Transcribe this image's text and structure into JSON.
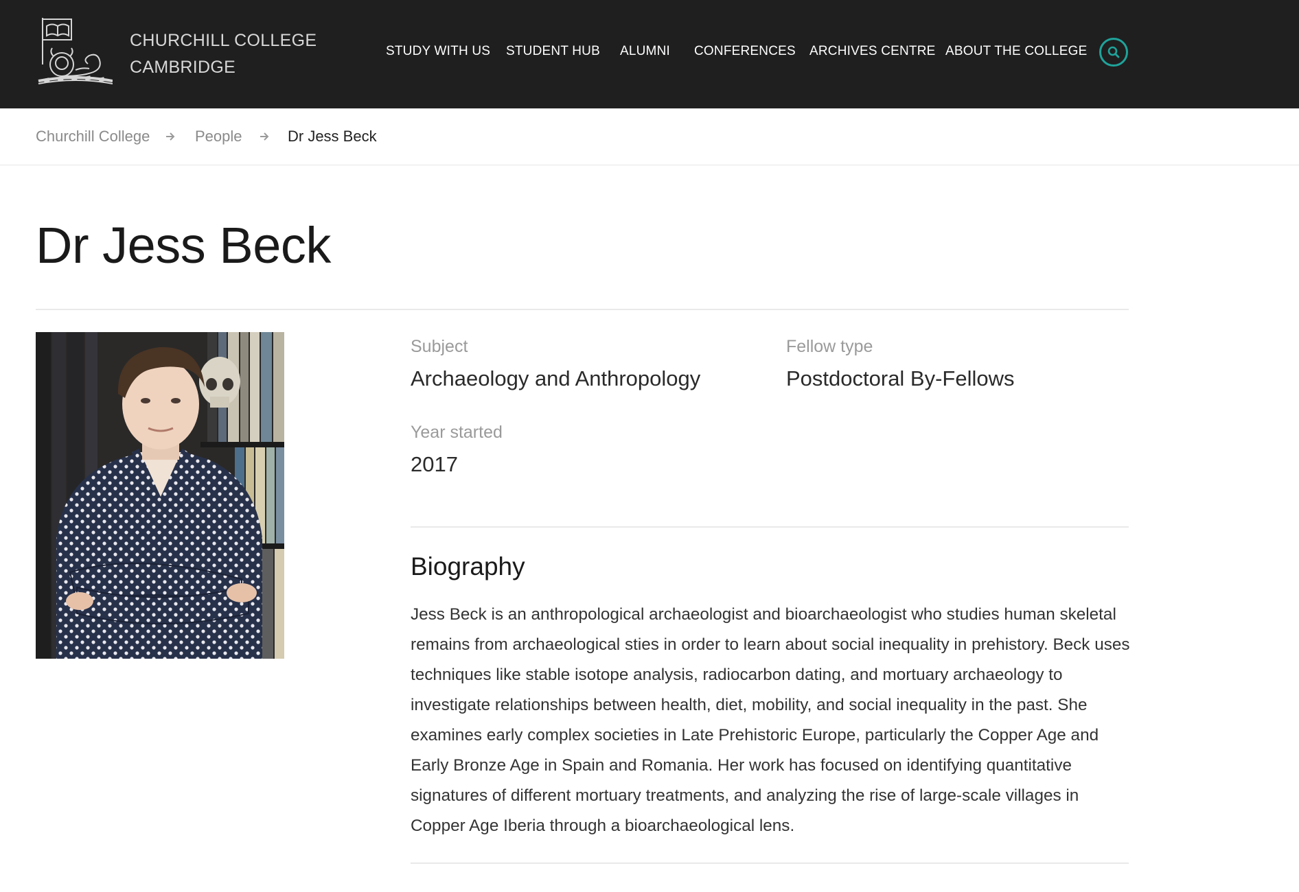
{
  "header": {
    "brand_line1": "CHURCHILL COLLEGE",
    "brand_line2": "CAMBRIDGE",
    "nav": [
      {
        "label": "STUDY WITH US"
      },
      {
        "label": "STUDENT HUB"
      },
      {
        "label": "ALUMNI"
      },
      {
        "label": "CONFERENCES"
      },
      {
        "label": "ARCHIVES CENTRE"
      },
      {
        "label": "ABOUT THE COLLEGE"
      }
    ],
    "search_icon": "search-icon",
    "accent_color": "#1fa39a",
    "background_color": "#1f1f20"
  },
  "breadcrumb": {
    "items": [
      {
        "label": "Churchill College"
      },
      {
        "label": "People"
      },
      {
        "label": "Dr Jess Beck"
      }
    ],
    "separator_icon": "arrow-right-icon"
  },
  "page": {
    "title": "Dr Jess Beck",
    "facts": {
      "subject_label": "Subject",
      "subject_value": "Archaeology and Anthropology",
      "fellow_type_label": "Fellow type",
      "fellow_type_value": "Postdoctoral By-Fellows",
      "year_started_label": "Year started",
      "year_started_value": "2017"
    },
    "biography": {
      "heading": "Biography",
      "text": "Jess Beck is an anthropological archaeologist and bioarchaeologist who studies human skeletal remains from archaeological sties in order to learn about social inequality in prehistory. Beck uses techniques like stable isotope analysis, radiocarbon dating, and mortuary archaeology to investigate relationships between health, diet, mobility, and social inequality in the past. She examines early complex societies in Late Prehistoric Europe, particularly the Copper Age and Early Bronze Age in Spain and Romania. Her work has focused on identifying quantitative signatures of different mortuary treatments, and analyzing the rise of large-scale villages in Copper Age Iberia through a bioarchaeological lens."
    }
  }
}
